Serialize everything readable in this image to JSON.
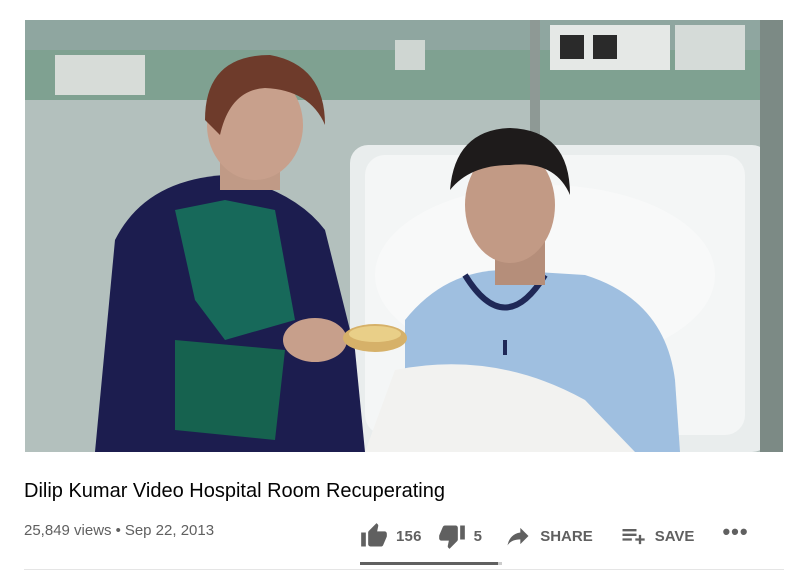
{
  "video": {
    "title": "Dilip Kumar Video Hospital Room Recuperating",
    "views": "25,849 views",
    "separator": "•",
    "date": "Sep 22, 2013"
  },
  "actions": {
    "like_count": "156",
    "dislike_count": "5",
    "share_label": "SHARE",
    "save_label": "SAVE",
    "more_label": "•••"
  },
  "sentiment": {
    "like_ratio": 0.97
  },
  "icons": {
    "like": "thumbs-up-icon",
    "dislike": "thumbs-down-icon",
    "share": "share-arrow-icon",
    "save": "playlist-add-icon",
    "more": "more-horizontal-icon"
  },
  "colors": {
    "text_primary": "#030303",
    "text_secondary": "#606060",
    "sentiment_fill": "#606060",
    "sentiment_track": "#cccccc"
  }
}
